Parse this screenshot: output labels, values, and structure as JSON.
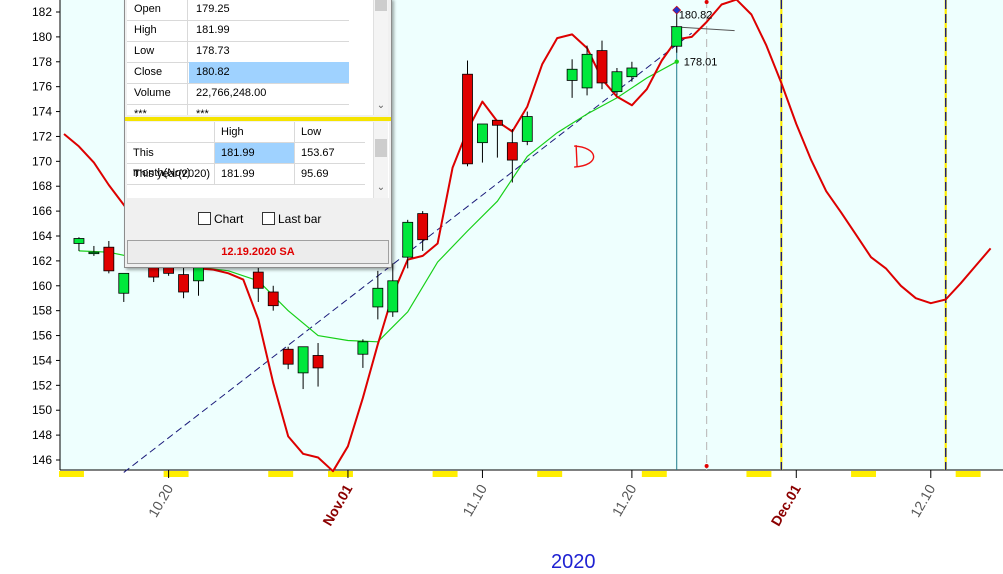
{
  "colors": {
    "plot_bg": "#eefffe",
    "up": "#00e83c",
    "down": "#e00000",
    "ma_red": "#dd0000",
    "ma_green": "#18d018",
    "trendline": "#1a1a7a",
    "year_label": "#1f22d2",
    "month_label": "#8b0000",
    "highlight": "#9fd2ff",
    "splitter": "#f5e400",
    "date_text": "#e00000",
    "axis_yellow": "#ffee00"
  },
  "chart_data": {
    "type": "candlestick",
    "ylim": [
      145,
      183
    ],
    "y_ticks": [
      146,
      148,
      150,
      152,
      154,
      156,
      158,
      160,
      162,
      164,
      166,
      168,
      170,
      172,
      174,
      176,
      178,
      180,
      182
    ],
    "x_date_range": [
      "2020-10-13",
      "2020-12-14"
    ],
    "x_ticks": [
      {
        "date": "2020-10-20",
        "label": "10.20",
        "color": "#555555"
      },
      {
        "date": "2020-11-01",
        "label": "Nov.01",
        "color": "#8b0000"
      },
      {
        "date": "2020-11-10",
        "label": "11.10",
        "color": "#555555"
      },
      {
        "date": "2020-11-20",
        "label": "11.20",
        "color": "#555555"
      },
      {
        "date": "2020-12-01",
        "label": "Dec.01",
        "color": "#8b0000"
      },
      {
        "date": "2020-12-10",
        "label": "12.10",
        "color": "#555555"
      }
    ],
    "year_label": "2020",
    "candles": [
      {
        "date": "2020-10-14",
        "open": 163.4,
        "high": 163.9,
        "low": 162.8,
        "close": 163.8
      },
      {
        "date": "2020-10-15",
        "open": 162.7,
        "high": 163.2,
        "low": 162.4,
        "close": 162.7
      },
      {
        "date": "2020-10-16",
        "open": 163.1,
        "high": 163.6,
        "low": 161.0,
        "close": 161.2
      },
      {
        "date": "2020-10-17",
        "open": 159.4,
        "high": 161.0,
        "low": 158.7,
        "close": 161.0
      },
      {
        "date": "2020-10-19",
        "open": 161.6,
        "high": 162.2,
        "low": 160.3,
        "close": 160.7
      },
      {
        "date": "2020-10-20",
        "open": 161.7,
        "high": 162.0,
        "low": 160.8,
        "close": 161.0
      },
      {
        "date": "2020-10-21",
        "open": 160.9,
        "high": 161.5,
        "low": 159.0,
        "close": 159.5
      },
      {
        "date": "2020-10-22",
        "open": 160.4,
        "high": 161.7,
        "low": 159.2,
        "close": 161.7
      },
      {
        "date": "2020-10-26",
        "open": 161.1,
        "high": 162.7,
        "low": 158.7,
        "close": 159.8
      },
      {
        "date": "2020-10-27",
        "open": 159.5,
        "high": 160.0,
        "low": 158.0,
        "close": 158.4
      },
      {
        "date": "2020-10-28",
        "open": 154.9,
        "high": 155.1,
        "low": 153.3,
        "close": 153.7
      },
      {
        "date": "2020-10-29",
        "open": 153.0,
        "high": 155.1,
        "low": 151.7,
        "close": 155.1
      },
      {
        "date": "2020-10-30",
        "open": 154.4,
        "high": 155.4,
        "low": 151.9,
        "close": 153.4
      },
      {
        "date": "2020-11-02",
        "open": 154.5,
        "high": 155.7,
        "low": 153.4,
        "close": 155.5
      },
      {
        "date": "2020-11-03",
        "open": 158.3,
        "high": 161.2,
        "low": 157.3,
        "close": 159.8
      },
      {
        "date": "2020-11-04",
        "open": 157.9,
        "high": 161.8,
        "low": 157.5,
        "close": 160.4
      },
      {
        "date": "2020-11-05",
        "open": 162.3,
        "high": 165.3,
        "low": 161.4,
        "close": 165.1
      },
      {
        "date": "2020-11-06",
        "open": 165.8,
        "high": 166.0,
        "low": 162.8,
        "close": 163.7
      },
      {
        "date": "2020-11-09",
        "open": 177.0,
        "high": 178.1,
        "low": 169.6,
        "close": 169.8
      },
      {
        "date": "2020-11-10",
        "open": 171.5,
        "high": 172.8,
        "low": 169.9,
        "close": 173.0
      },
      {
        "date": "2020-11-11",
        "open": 173.3,
        "high": 173.3,
        "low": 170.3,
        "close": 172.9
      },
      {
        "date": "2020-11-12",
        "open": 171.5,
        "high": 172.6,
        "low": 168.3,
        "close": 170.1
      },
      {
        "date": "2020-11-13",
        "open": 171.6,
        "high": 174.0,
        "low": 171.3,
        "close": 173.6
      },
      {
        "date": "2020-11-16",
        "open": 176.5,
        "high": 178.2,
        "low": 175.1,
        "close": 177.4
      },
      {
        "date": "2020-11-17",
        "open": 175.9,
        "high": 179.3,
        "low": 175.3,
        "close": 178.6
      },
      {
        "date": "2020-11-18",
        "open": 178.9,
        "high": 179.7,
        "low": 175.8,
        "close": 176.3
      },
      {
        "date": "2020-11-19",
        "open": 175.6,
        "high": 177.5,
        "low": 175.3,
        "close": 177.2
      },
      {
        "date": "2020-11-20",
        "open": 176.8,
        "high": 178.0,
        "low": 176.4,
        "close": 177.5
      },
      {
        "date": "2020-11-23",
        "open": 179.25,
        "high": 181.99,
        "low": 178.73,
        "close": 180.82
      }
    ],
    "ma_red": [
      [
        "2020-10-13",
        172.2
      ],
      [
        "2020-10-14",
        171.2
      ],
      [
        "2020-10-15",
        169.9
      ],
      [
        "2020-10-16",
        168.1
      ],
      [
        "2020-10-17",
        166.5
      ],
      [
        "2020-10-18",
        164.9
      ],
      [
        "2020-10-19",
        163.3
      ],
      [
        "2020-10-20",
        162.3
      ],
      [
        "2020-10-21",
        161.9
      ],
      [
        "2020-10-22",
        161.4
      ],
      [
        "2020-10-23",
        161.3
      ],
      [
        "2020-10-24",
        161.0
      ],
      [
        "2020-10-25",
        160.5
      ],
      [
        "2020-10-26",
        157.3
      ],
      [
        "2020-10-27",
        152.2
      ],
      [
        "2020-10-28",
        147.9
      ],
      [
        "2020-10-29",
        146.5
      ],
      [
        "2020-10-30",
        146.2
      ],
      [
        "2020-10-31",
        145.1
      ],
      [
        "2020-11-01",
        147.1
      ],
      [
        "2020-11-02",
        151.0
      ],
      [
        "2020-11-03",
        155.3
      ],
      [
        "2020-11-04",
        159.3
      ],
      [
        "2020-11-05",
        162.1
      ],
      [
        "2020-11-06",
        162.4
      ],
      [
        "2020-11-07",
        163.4
      ],
      [
        "2020-11-08",
        169.5
      ],
      [
        "2020-11-09",
        172.5
      ],
      [
        "2020-11-10",
        174.8
      ],
      [
        "2020-11-11",
        173.2
      ],
      [
        "2020-11-12",
        172.4
      ],
      [
        "2020-11-13",
        174.4
      ],
      [
        "2020-11-14",
        177.8
      ],
      [
        "2020-11-15",
        179.9
      ],
      [
        "2020-11-16",
        180.2
      ],
      [
        "2020-11-17",
        179.1
      ],
      [
        "2020-11-18",
        176.6
      ],
      [
        "2020-11-19",
        175.2
      ],
      [
        "2020-11-20",
        174.5
      ],
      [
        "2020-11-21",
        175.8
      ],
      [
        "2020-11-22",
        178.1
      ],
      [
        "2020-11-23",
        179.8
      ],
      [
        "2020-11-24",
        180.0
      ],
      [
        "2020-11-25",
        181.2
      ],
      [
        "2020-11-26",
        182.6
      ],
      [
        "2020-11-27",
        183.0
      ],
      [
        "2020-11-28",
        181.8
      ],
      [
        "2020-11-29",
        179.3
      ],
      [
        "2020-11-30",
        176.3
      ],
      [
        "2020-12-01",
        173.0
      ],
      [
        "2020-12-02",
        170.1
      ],
      [
        "2020-12-03",
        167.6
      ],
      [
        "2020-12-04",
        165.9
      ],
      [
        "2020-12-05",
        164.1
      ],
      [
        "2020-12-06",
        162.3
      ],
      [
        "2020-12-07",
        161.4
      ],
      [
        "2020-12-08",
        160.0
      ],
      [
        "2020-12-09",
        159.0
      ],
      [
        "2020-12-10",
        158.6
      ],
      [
        "2020-12-11",
        158.9
      ],
      [
        "2020-12-12",
        160.2
      ],
      [
        "2020-12-13",
        161.6
      ],
      [
        "2020-12-14",
        163.0
      ]
    ],
    "ma_green": [
      [
        "2020-10-14",
        162.8
      ],
      [
        "2020-10-16",
        162.7
      ],
      [
        "2020-10-18",
        162.2
      ],
      [
        "2020-10-20",
        161.7
      ],
      [
        "2020-10-22",
        161.5
      ],
      [
        "2020-10-24",
        161.2
      ],
      [
        "2020-10-26",
        160.4
      ],
      [
        "2020-10-28",
        158.0
      ],
      [
        "2020-10-30",
        156.0
      ],
      [
        "2020-11-01",
        155.6
      ],
      [
        "2020-11-03",
        155.5
      ],
      [
        "2020-11-05",
        157.9
      ],
      [
        "2020-11-07",
        161.9
      ],
      [
        "2020-11-09",
        164.4
      ],
      [
        "2020-11-11",
        166.8
      ],
      [
        "2020-11-13",
        170.4
      ],
      [
        "2020-11-15",
        172.3
      ],
      [
        "2020-11-17",
        173.8
      ],
      [
        "2020-11-19",
        175.1
      ],
      [
        "2020-11-21",
        176.7
      ],
      [
        "2020-11-23",
        178.01
      ]
    ],
    "trendline": [
      [
        "2020-10-17",
        145.0
      ],
      [
        "2020-11-24",
        180.3
      ]
    ],
    "current_date": "2020-11-23",
    "markers": [
      {
        "date": "2020-11-23",
        "value": 180.82,
        "label": "180.82"
      },
      {
        "date": "2020-11-23",
        "value": 178.01,
        "label": "178.01"
      }
    ],
    "vlines": [
      {
        "date": "2020-11-25",
        "style": "dashed-red"
      },
      {
        "date": "2020-11-30",
        "style": "dashed-navy-yellow"
      },
      {
        "date": "2020-12-11",
        "style": "dashed-navy-yellow"
      }
    ],
    "annotation": "D",
    "axis_yellow_segments": [
      [
        "2020-10-13",
        "2020-10-14"
      ],
      [
        "2020-10-20",
        "2020-10-21"
      ],
      [
        "2020-10-27",
        "2020-10-28"
      ],
      [
        "2020-10-31",
        "2020-11-01"
      ],
      [
        "2020-11-07",
        "2020-11-08"
      ],
      [
        "2020-11-14",
        "2020-11-15"
      ],
      [
        "2020-11-21",
        "2020-11-22"
      ],
      [
        "2020-11-28",
        "2020-11-29"
      ],
      [
        "2020-12-05",
        "2020-12-06"
      ],
      [
        "2020-12-12",
        "2020-12-13"
      ]
    ]
  },
  "panel": {
    "ohlc_rows": [
      {
        "key": "Open",
        "value": "179.25"
      },
      {
        "key": "High",
        "value": "181.99"
      },
      {
        "key": "Low",
        "value": "178.73"
      },
      {
        "key": "Close",
        "value": "180.82"
      },
      {
        "key": "Volume",
        "value": "22,766,248.00"
      },
      {
        "key": "***",
        "value": "***"
      }
    ],
    "hl_header": [
      "",
      "High",
      "Low"
    ],
    "hl_rows": [
      {
        "label": "This month(Nov)",
        "high": "181.99",
        "low": "153.67"
      },
      {
        "label": "This year(2020)",
        "high": "181.99",
        "low": "95.69"
      }
    ],
    "chart_checkbox": "Chart",
    "lastbar_checkbox": "Last bar",
    "date_label": "12.19.2020 SA"
  }
}
